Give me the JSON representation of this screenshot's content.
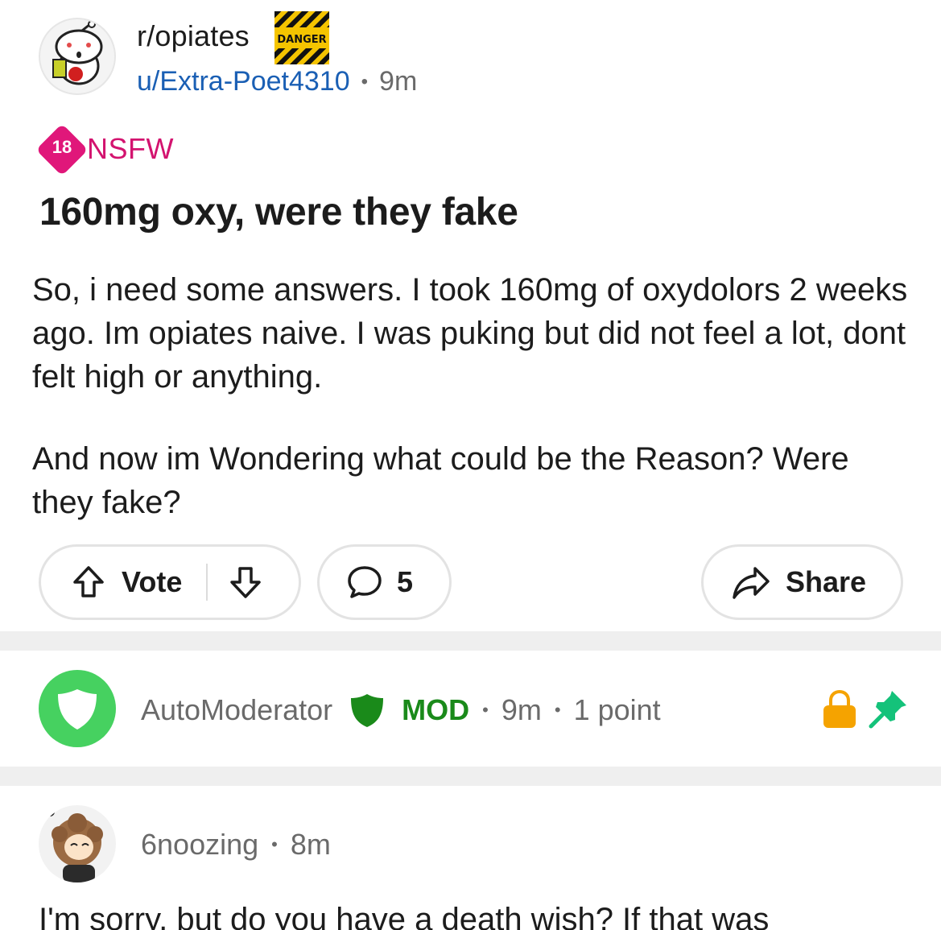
{
  "post": {
    "subreddit": "r/opiates",
    "flair_text": "DANGER",
    "author": "u/Extra-Poet4310",
    "time": "9m",
    "nsfw_age": "18",
    "nsfw_label": "NSFW",
    "title": "160mg oxy, were they fake",
    "body": [
      "So, i need some answers.  I took 160mg of oxydolors 2 weeks ago. Im opiates naive. I was puking  but did not feel a lot, dont felt high or anything.",
      "And now im Wondering what could be the Reason? Were they fake?"
    ]
  },
  "actions": {
    "vote_label": "Vote",
    "comment_count": "5",
    "share_label": "Share"
  },
  "comments": [
    {
      "author": "AutoModerator",
      "mod_label": "MOD",
      "time": "9m",
      "points": "1 point",
      "icons": [
        "shield-icon",
        "lock-icon",
        "pin-icon"
      ]
    },
    {
      "author": "6noozing",
      "time": "8m",
      "text": "I'm sorry, but do you have a death wish? If that was"
    }
  ],
  "colors": {
    "nsfw": "#e0177a",
    "link": "#1a5fb4",
    "mod_green": "#1a8a1a",
    "automod_avatar": "#46d160",
    "lock": "#f5a300",
    "pin": "#14c27a"
  }
}
